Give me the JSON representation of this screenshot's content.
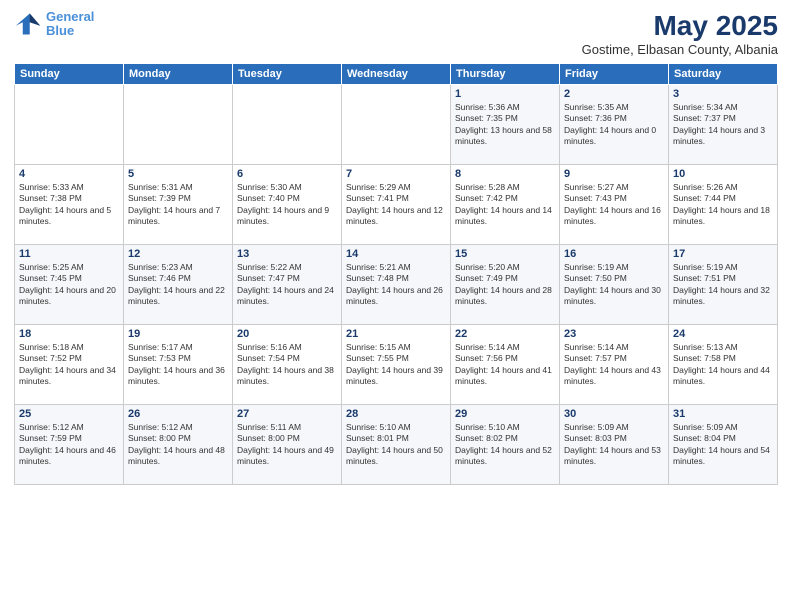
{
  "header": {
    "logo_line1": "General",
    "logo_line2": "Blue",
    "month_title": "May 2025",
    "subtitle": "Gostime, Elbasan County, Albania"
  },
  "days_of_week": [
    "Sunday",
    "Monday",
    "Tuesday",
    "Wednesday",
    "Thursday",
    "Friday",
    "Saturday"
  ],
  "weeks": [
    [
      {
        "day": "",
        "sunrise": "",
        "sunset": "",
        "daylight": ""
      },
      {
        "day": "",
        "sunrise": "",
        "sunset": "",
        "daylight": ""
      },
      {
        "day": "",
        "sunrise": "",
        "sunset": "",
        "daylight": ""
      },
      {
        "day": "",
        "sunrise": "",
        "sunset": "",
        "daylight": ""
      },
      {
        "day": "1",
        "sunrise": "Sunrise: 5:36 AM",
        "sunset": "Sunset: 7:35 PM",
        "daylight": "Daylight: 13 hours and 58 minutes."
      },
      {
        "day": "2",
        "sunrise": "Sunrise: 5:35 AM",
        "sunset": "Sunset: 7:36 PM",
        "daylight": "Daylight: 14 hours and 0 minutes."
      },
      {
        "day": "3",
        "sunrise": "Sunrise: 5:34 AM",
        "sunset": "Sunset: 7:37 PM",
        "daylight": "Daylight: 14 hours and 3 minutes."
      }
    ],
    [
      {
        "day": "4",
        "sunrise": "Sunrise: 5:33 AM",
        "sunset": "Sunset: 7:38 PM",
        "daylight": "Daylight: 14 hours and 5 minutes."
      },
      {
        "day": "5",
        "sunrise": "Sunrise: 5:31 AM",
        "sunset": "Sunset: 7:39 PM",
        "daylight": "Daylight: 14 hours and 7 minutes."
      },
      {
        "day": "6",
        "sunrise": "Sunrise: 5:30 AM",
        "sunset": "Sunset: 7:40 PM",
        "daylight": "Daylight: 14 hours and 9 minutes."
      },
      {
        "day": "7",
        "sunrise": "Sunrise: 5:29 AM",
        "sunset": "Sunset: 7:41 PM",
        "daylight": "Daylight: 14 hours and 12 minutes."
      },
      {
        "day": "8",
        "sunrise": "Sunrise: 5:28 AM",
        "sunset": "Sunset: 7:42 PM",
        "daylight": "Daylight: 14 hours and 14 minutes."
      },
      {
        "day": "9",
        "sunrise": "Sunrise: 5:27 AM",
        "sunset": "Sunset: 7:43 PM",
        "daylight": "Daylight: 14 hours and 16 minutes."
      },
      {
        "day": "10",
        "sunrise": "Sunrise: 5:26 AM",
        "sunset": "Sunset: 7:44 PM",
        "daylight": "Daylight: 14 hours and 18 minutes."
      }
    ],
    [
      {
        "day": "11",
        "sunrise": "Sunrise: 5:25 AM",
        "sunset": "Sunset: 7:45 PM",
        "daylight": "Daylight: 14 hours and 20 minutes."
      },
      {
        "day": "12",
        "sunrise": "Sunrise: 5:23 AM",
        "sunset": "Sunset: 7:46 PM",
        "daylight": "Daylight: 14 hours and 22 minutes."
      },
      {
        "day": "13",
        "sunrise": "Sunrise: 5:22 AM",
        "sunset": "Sunset: 7:47 PM",
        "daylight": "Daylight: 14 hours and 24 minutes."
      },
      {
        "day": "14",
        "sunrise": "Sunrise: 5:21 AM",
        "sunset": "Sunset: 7:48 PM",
        "daylight": "Daylight: 14 hours and 26 minutes."
      },
      {
        "day": "15",
        "sunrise": "Sunrise: 5:20 AM",
        "sunset": "Sunset: 7:49 PM",
        "daylight": "Daylight: 14 hours and 28 minutes."
      },
      {
        "day": "16",
        "sunrise": "Sunrise: 5:19 AM",
        "sunset": "Sunset: 7:50 PM",
        "daylight": "Daylight: 14 hours and 30 minutes."
      },
      {
        "day": "17",
        "sunrise": "Sunrise: 5:19 AM",
        "sunset": "Sunset: 7:51 PM",
        "daylight": "Daylight: 14 hours and 32 minutes."
      }
    ],
    [
      {
        "day": "18",
        "sunrise": "Sunrise: 5:18 AM",
        "sunset": "Sunset: 7:52 PM",
        "daylight": "Daylight: 14 hours and 34 minutes."
      },
      {
        "day": "19",
        "sunrise": "Sunrise: 5:17 AM",
        "sunset": "Sunset: 7:53 PM",
        "daylight": "Daylight: 14 hours and 36 minutes."
      },
      {
        "day": "20",
        "sunrise": "Sunrise: 5:16 AM",
        "sunset": "Sunset: 7:54 PM",
        "daylight": "Daylight: 14 hours and 38 minutes."
      },
      {
        "day": "21",
        "sunrise": "Sunrise: 5:15 AM",
        "sunset": "Sunset: 7:55 PM",
        "daylight": "Daylight: 14 hours and 39 minutes."
      },
      {
        "day": "22",
        "sunrise": "Sunrise: 5:14 AM",
        "sunset": "Sunset: 7:56 PM",
        "daylight": "Daylight: 14 hours and 41 minutes."
      },
      {
        "day": "23",
        "sunrise": "Sunrise: 5:14 AM",
        "sunset": "Sunset: 7:57 PM",
        "daylight": "Daylight: 14 hours and 43 minutes."
      },
      {
        "day": "24",
        "sunrise": "Sunrise: 5:13 AM",
        "sunset": "Sunset: 7:58 PM",
        "daylight": "Daylight: 14 hours and 44 minutes."
      }
    ],
    [
      {
        "day": "25",
        "sunrise": "Sunrise: 5:12 AM",
        "sunset": "Sunset: 7:59 PM",
        "daylight": "Daylight: 14 hours and 46 minutes."
      },
      {
        "day": "26",
        "sunrise": "Sunrise: 5:12 AM",
        "sunset": "Sunset: 8:00 PM",
        "daylight": "Daylight: 14 hours and 48 minutes."
      },
      {
        "day": "27",
        "sunrise": "Sunrise: 5:11 AM",
        "sunset": "Sunset: 8:00 PM",
        "daylight": "Daylight: 14 hours and 49 minutes."
      },
      {
        "day": "28",
        "sunrise": "Sunrise: 5:10 AM",
        "sunset": "Sunset: 8:01 PM",
        "daylight": "Daylight: 14 hours and 50 minutes."
      },
      {
        "day": "29",
        "sunrise": "Sunrise: 5:10 AM",
        "sunset": "Sunset: 8:02 PM",
        "daylight": "Daylight: 14 hours and 52 minutes."
      },
      {
        "day": "30",
        "sunrise": "Sunrise: 5:09 AM",
        "sunset": "Sunset: 8:03 PM",
        "daylight": "Daylight: 14 hours and 53 minutes."
      },
      {
        "day": "31",
        "sunrise": "Sunrise: 5:09 AM",
        "sunset": "Sunset: 8:04 PM",
        "daylight": "Daylight: 14 hours and 54 minutes."
      }
    ]
  ]
}
